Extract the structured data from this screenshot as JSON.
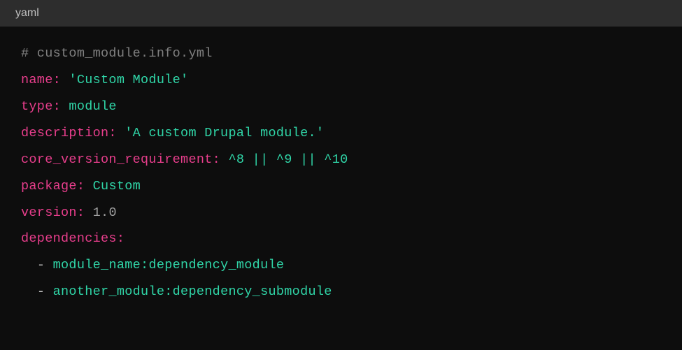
{
  "header": {
    "language": "yaml"
  },
  "code": {
    "comment": "# custom_module.info.yml",
    "lines": [
      {
        "key": "name",
        "value": "'Custom Module'",
        "value_class": "string"
      },
      {
        "key": "type",
        "value": "module",
        "value_class": "value"
      },
      {
        "key": "description",
        "value": "'A custom Drupal module.'",
        "value_class": "string"
      },
      {
        "key": "core_version_requirement",
        "value": "^8 || ^9 || ^10",
        "value_class": "value"
      },
      {
        "key": "package",
        "value": "Custom",
        "value_class": "value"
      },
      {
        "key": "version",
        "value": "1.0",
        "value_class": "float"
      }
    ],
    "dependencies_key": "dependencies",
    "dependencies": [
      "module_name:dependency_module",
      "another_module:dependency_submodule"
    ]
  }
}
